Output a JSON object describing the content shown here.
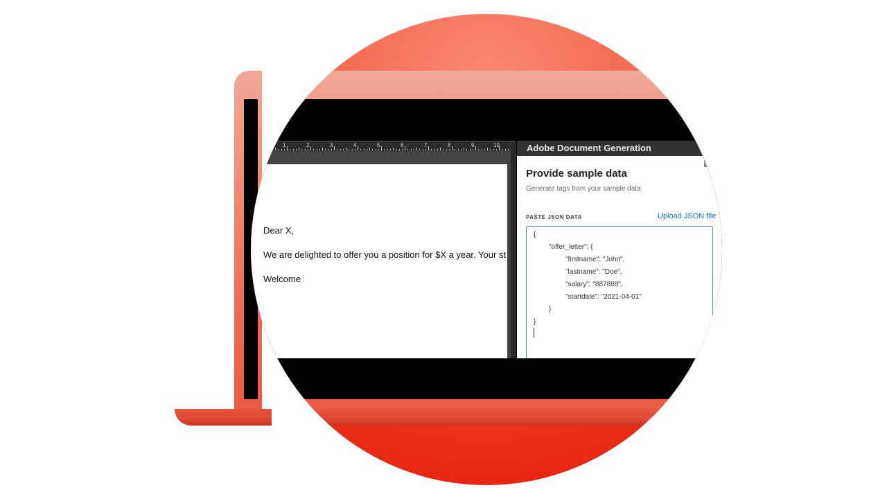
{
  "ruler": {
    "numbers": [
      "1",
      "2",
      "3",
      "4",
      "5",
      "6",
      "7",
      "8",
      "9",
      "10"
    ]
  },
  "document": {
    "line1": "Dear X,",
    "line2": "We are delighted to offer you a position for $X a year. Your st",
    "line3": "Welcome"
  },
  "panel": {
    "title": "Adobe Document Generation",
    "heading": "Provide sample data",
    "subtitle": "Generate tags from your sample data",
    "paste_label": "PASTE JSON DATA",
    "upload_link": "Upload JSON file",
    "json_lines": [
      "{",
      "\"offer_letter\": {",
      "\"firstname\": \"John\",",
      "\"lastname\": \"Doe\",",
      "\"salary\": \"887888\",",
      "\"startdate\": \"2021-04-01\"",
      "}",
      "}"
    ]
  },
  "colors": {
    "accent_link": "#1473e6",
    "focus_border": "#4a90e2",
    "brand_red": "#e11a05"
  }
}
